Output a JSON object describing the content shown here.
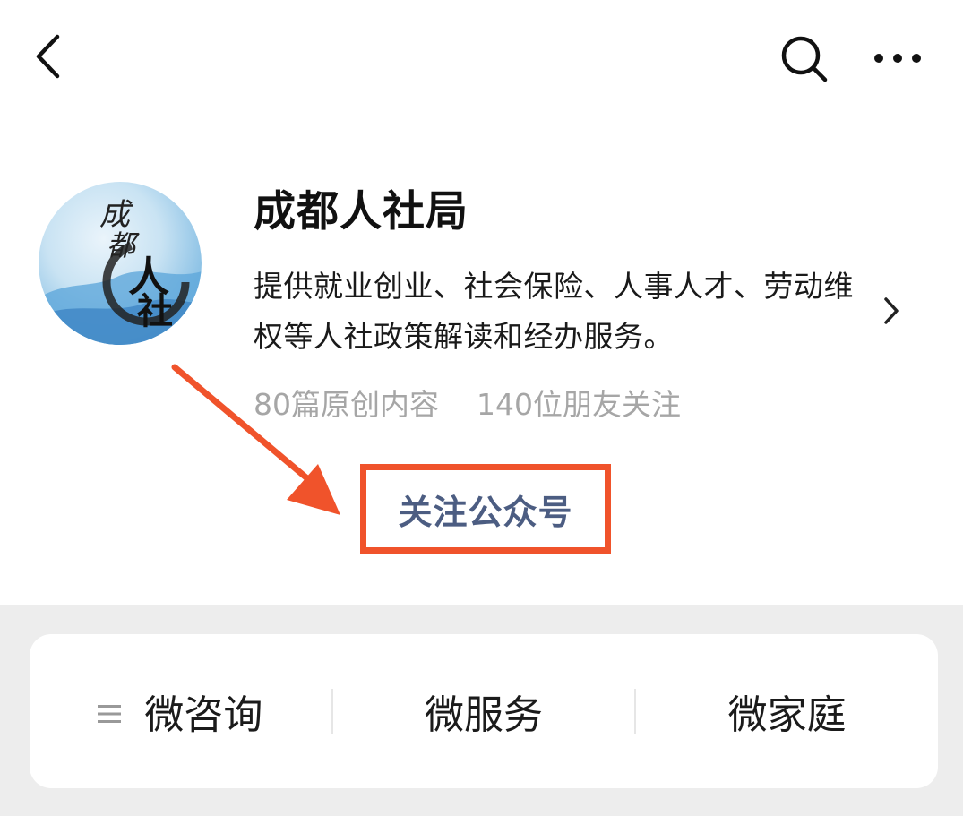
{
  "topbar": {
    "back_icon": "chevron-left-icon",
    "search_icon": "search-icon",
    "more_icon": "more-dots-icon"
  },
  "profile": {
    "name": "成都人社局",
    "description": "提供就业创业、社会保险、人事人才、劳动维权等人社政策解读和经办服务。",
    "stats": {
      "articles": "80篇原创内容",
      "followers": "140位朋友关注"
    },
    "avatar": {
      "logo_text_1": "成",
      "logo_text_2": "都",
      "logo_text_3": "人",
      "logo_text_4": "社"
    }
  },
  "follow_button": {
    "label": "关注公众号",
    "highlight_color": "#f0532b"
  },
  "menu": {
    "items": [
      {
        "label": "微咨询",
        "icon": "menu-list-icon"
      },
      {
        "label": "微服务"
      },
      {
        "label": "微家庭"
      }
    ]
  },
  "colors": {
    "accent_link": "#4c5d82",
    "annotation": "#f0532b",
    "muted_text": "#a6a6a6",
    "background_gray": "#ededed"
  }
}
